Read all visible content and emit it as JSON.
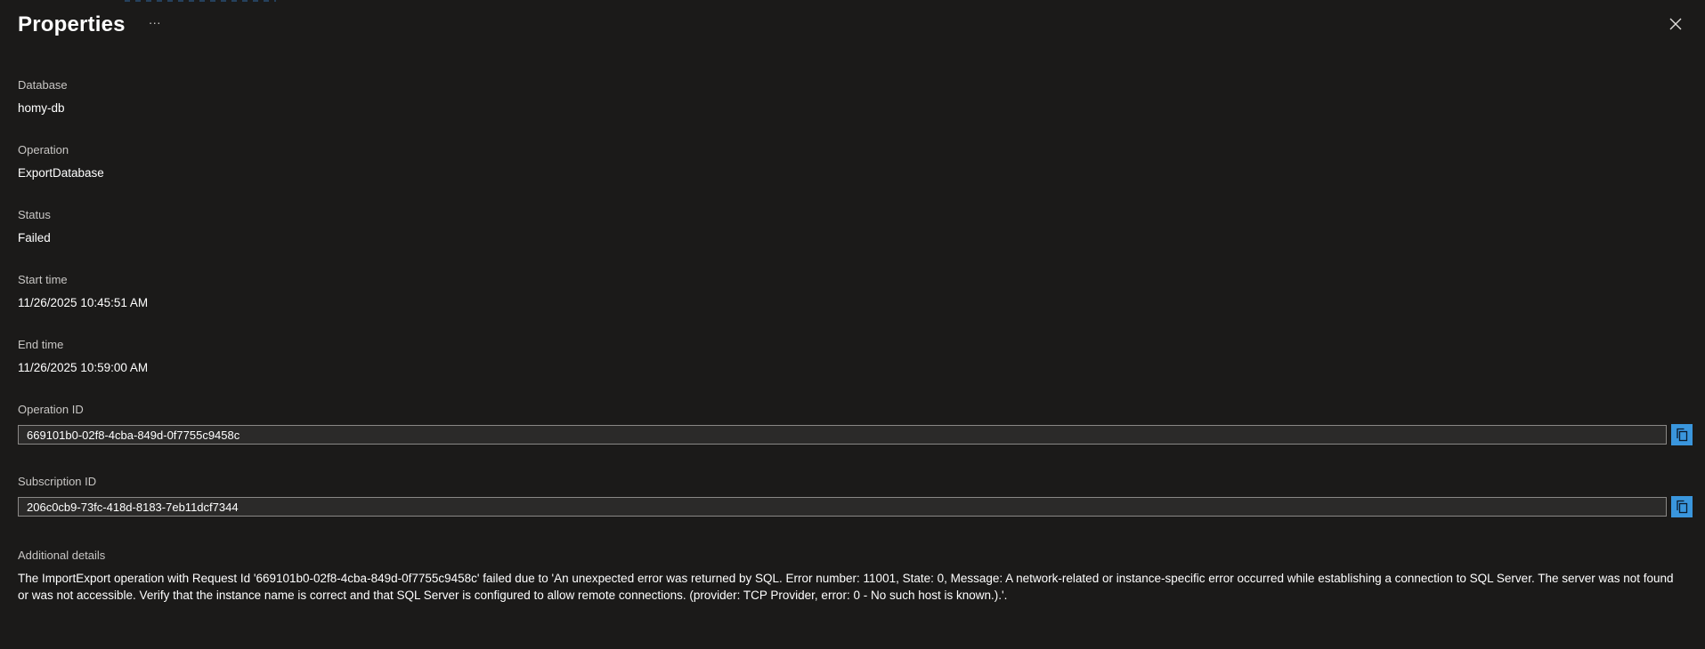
{
  "panel": {
    "title": "Properties",
    "more_label": "···"
  },
  "fields": {
    "database": {
      "label": "Database",
      "value": "homy-db"
    },
    "operation": {
      "label": "Operation",
      "value": "ExportDatabase"
    },
    "status": {
      "label": "Status",
      "value": "Failed"
    },
    "start_time": {
      "label": "Start time",
      "value": "11/26/2025 10:45:51 AM"
    },
    "end_time": {
      "label": "End time",
      "value": "11/26/2025 10:59:00 AM"
    },
    "operation_id": {
      "label": "Operation ID",
      "value": "669101b0-02f8-4cba-849d-0f7755c9458c"
    },
    "subscription_id": {
      "label": "Subscription ID",
      "value": "206c0cb9-73fc-418d-8183-7eb11dcf7344"
    },
    "additional_details": {
      "label": "Additional details",
      "value": "The ImportExport operation with Request Id '669101b0-02f8-4cba-849d-0f7755c9458c' failed due to 'An unexpected error was returned by SQL. Error number: 11001, State: 0, Message: A network-related or instance-specific error occurred while establishing a connection to SQL Server. The server was not found or was not accessible. Verify that the instance name is correct and that SQL Server is configured to allow remote connections. (provider: TCP Provider, error: 0 - No such host is known.).'."
    }
  },
  "icons": {
    "close": "close-icon",
    "copy": "copy-icon",
    "more": "more-icon"
  },
  "colors": {
    "background": "#1b1a19",
    "accent": "#3a96dd",
    "label": "#c8c6c4",
    "input_border": "#8a8886"
  }
}
